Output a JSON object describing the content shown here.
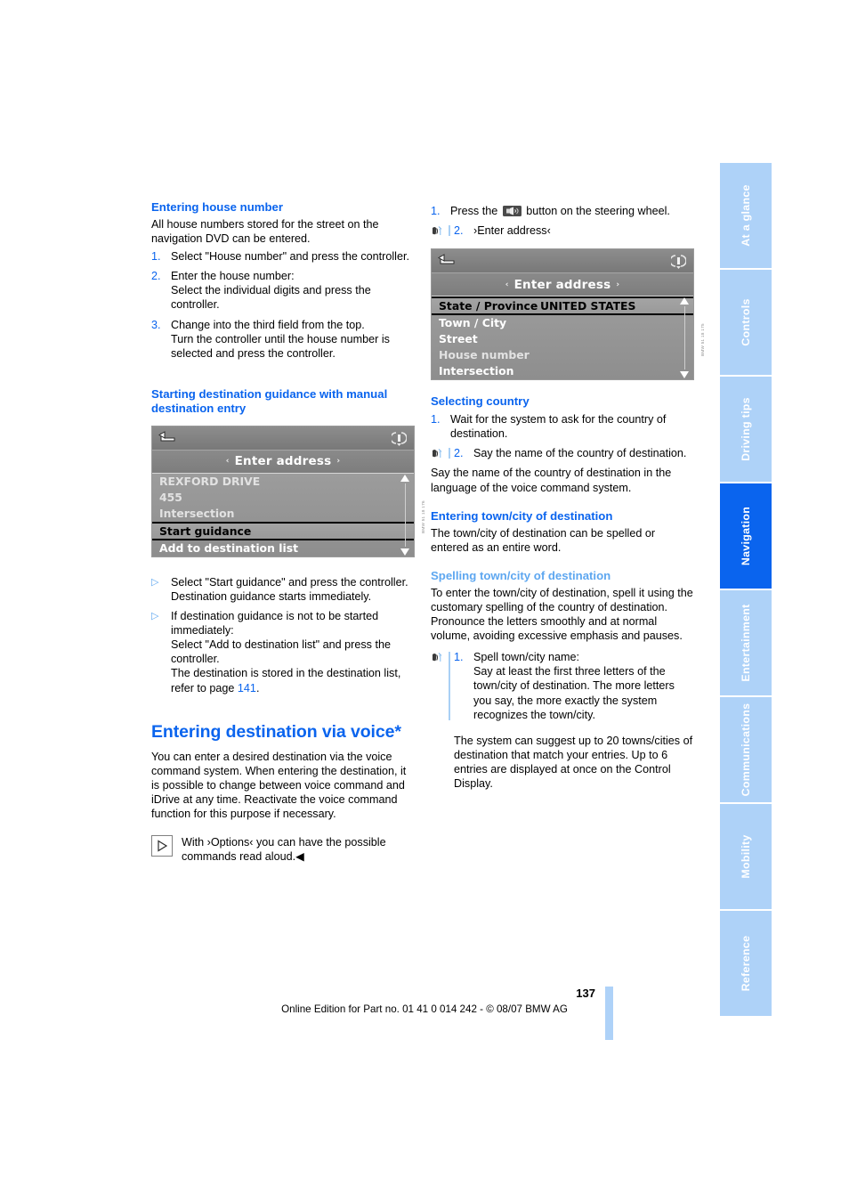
{
  "left_column": {
    "section1": {
      "heading": "Entering house number",
      "intro": "All house numbers stored for the street on the navigation DVD can be entered.",
      "steps": [
        {
          "num": "1.",
          "text": "Select \"House number\" and press the controller."
        },
        {
          "num": "2.",
          "text": "Enter the house number:",
          "sub": "Select the individual digits and press the controller."
        },
        {
          "num": "3.",
          "text": "Change into the third field from the top.",
          "sub": "Turn the controller until the house number is selected and press the controller."
        }
      ]
    },
    "section2": {
      "heading": "Starting destination guidance with manual destination entry",
      "screen": {
        "title": "Enter address",
        "left_arrow": "‹",
        "right_arrow": "›",
        "rows": [
          {
            "label": "REXFORD DRIVE",
            "value": "",
            "selected": false,
            "dim": true
          },
          {
            "label": "455",
            "value": "",
            "selected": false,
            "dim": true
          },
          {
            "label": "Intersection",
            "value": "",
            "selected": false,
            "dim": true
          },
          {
            "label": "Start guidance",
            "value": "",
            "selected": true,
            "dim": false
          },
          {
            "label": "Add to destination list",
            "value": "",
            "selected": false,
            "dim": false
          }
        ],
        "figure_code": "BMW 51 18 176"
      },
      "bullets": [
        {
          "text": "Select \"Start guidance\" and press the controller.",
          "sub": "Destination guidance starts immediately."
        },
        {
          "text": "If destination guidance is not to be started immediately:",
          "sub": "Select \"Add to destination list\" and press the controller.",
          "sub2_pre": "The destination is stored in the destination list, refer to page ",
          "sub2_ref": "141",
          "sub2_post": "."
        }
      ]
    },
    "section3": {
      "heading": "Entering destination via voice*",
      "body": "You can enter a desired destination via the voice command system. When entering the destination, it is possible to change between voice command and iDrive at any time. Reactivate the voice command function for this purpose if necessary.",
      "note": "With ›Options‹ you can have the possible commands read aloud.◀"
    }
  },
  "right_column": {
    "top_steps": [
      {
        "num": "1.",
        "pre": "Press the ",
        "post": " button on the steering wheel.",
        "icon": "steering-wheel-voice-button-icon"
      },
      {
        "num": "2.",
        "text": "›Enter address‹",
        "voice": true
      }
    ],
    "screen": {
      "title": "Enter address",
      "left_arrow": "‹",
      "right_arrow": "›",
      "rows": [
        {
          "label": "State / Province",
          "value": "UNITED STATES",
          "selected": true,
          "dim": false
        },
        {
          "label": "Town / City",
          "value": "",
          "selected": false,
          "dim": false
        },
        {
          "label": "Street",
          "value": "",
          "selected": false,
          "dim": false
        },
        {
          "label": "House number",
          "value": "",
          "selected": false,
          "dim": true
        },
        {
          "label": "Intersection",
          "value": "",
          "selected": false,
          "dim": false
        }
      ],
      "figure_code": "BMW 51 18 175"
    },
    "section_country": {
      "heading": "Selecting country",
      "steps": [
        {
          "num": "1.",
          "text": "Wait for the system to ask for the country of destination.",
          "voice": false
        },
        {
          "num": "2.",
          "text": "Say the name of the country of destination.",
          "voice": true
        }
      ],
      "body": "Say the name of the country of destination in the language of the voice command system."
    },
    "section_town": {
      "heading": "Entering town/city of destination",
      "body": "The town/city of destination can be spelled or entered as an entire word."
    },
    "section_spelling": {
      "heading": "Spelling town/city of destination",
      "body1": "To enter the town/city of destination, spell it using the customary spelling of the country of destination.",
      "body2": "Pronounce the letters smoothly and at normal volume, avoiding excessive emphasis and pauses.",
      "step": {
        "num": "1.",
        "text": "Spell town/city name:",
        "sub": "Say at least the first three letters of the town/city of destination. The more letters you say, the more exactly the system recognizes the town/city.",
        "voice": true
      },
      "body3": "The system can suggest up to 20 towns/cities of destination that match your entries. Up to 6 entries are displayed at once on the Control Display."
    }
  },
  "sidebar": {
    "tabs": [
      {
        "label": "At a glance",
        "active": false
      },
      {
        "label": "Controls",
        "active": false
      },
      {
        "label": "Driving tips",
        "active": false
      },
      {
        "label": "Navigation",
        "active": true
      },
      {
        "label": "Entertainment",
        "active": false
      },
      {
        "label": "Communications",
        "active": false
      },
      {
        "label": "Mobility",
        "active": false
      },
      {
        "label": "Reference",
        "active": false
      }
    ]
  },
  "footer": {
    "page_number": "137",
    "text": "Online Edition for Part no. 01 41 0 014 242 - © 08/07 BMW AG"
  },
  "colors": {
    "heading_blue": "#0a64ee",
    "subheading_blue": "#5ea7f0",
    "tab_blue": "#aed2f8",
    "tab_active": "#0a64ee"
  }
}
